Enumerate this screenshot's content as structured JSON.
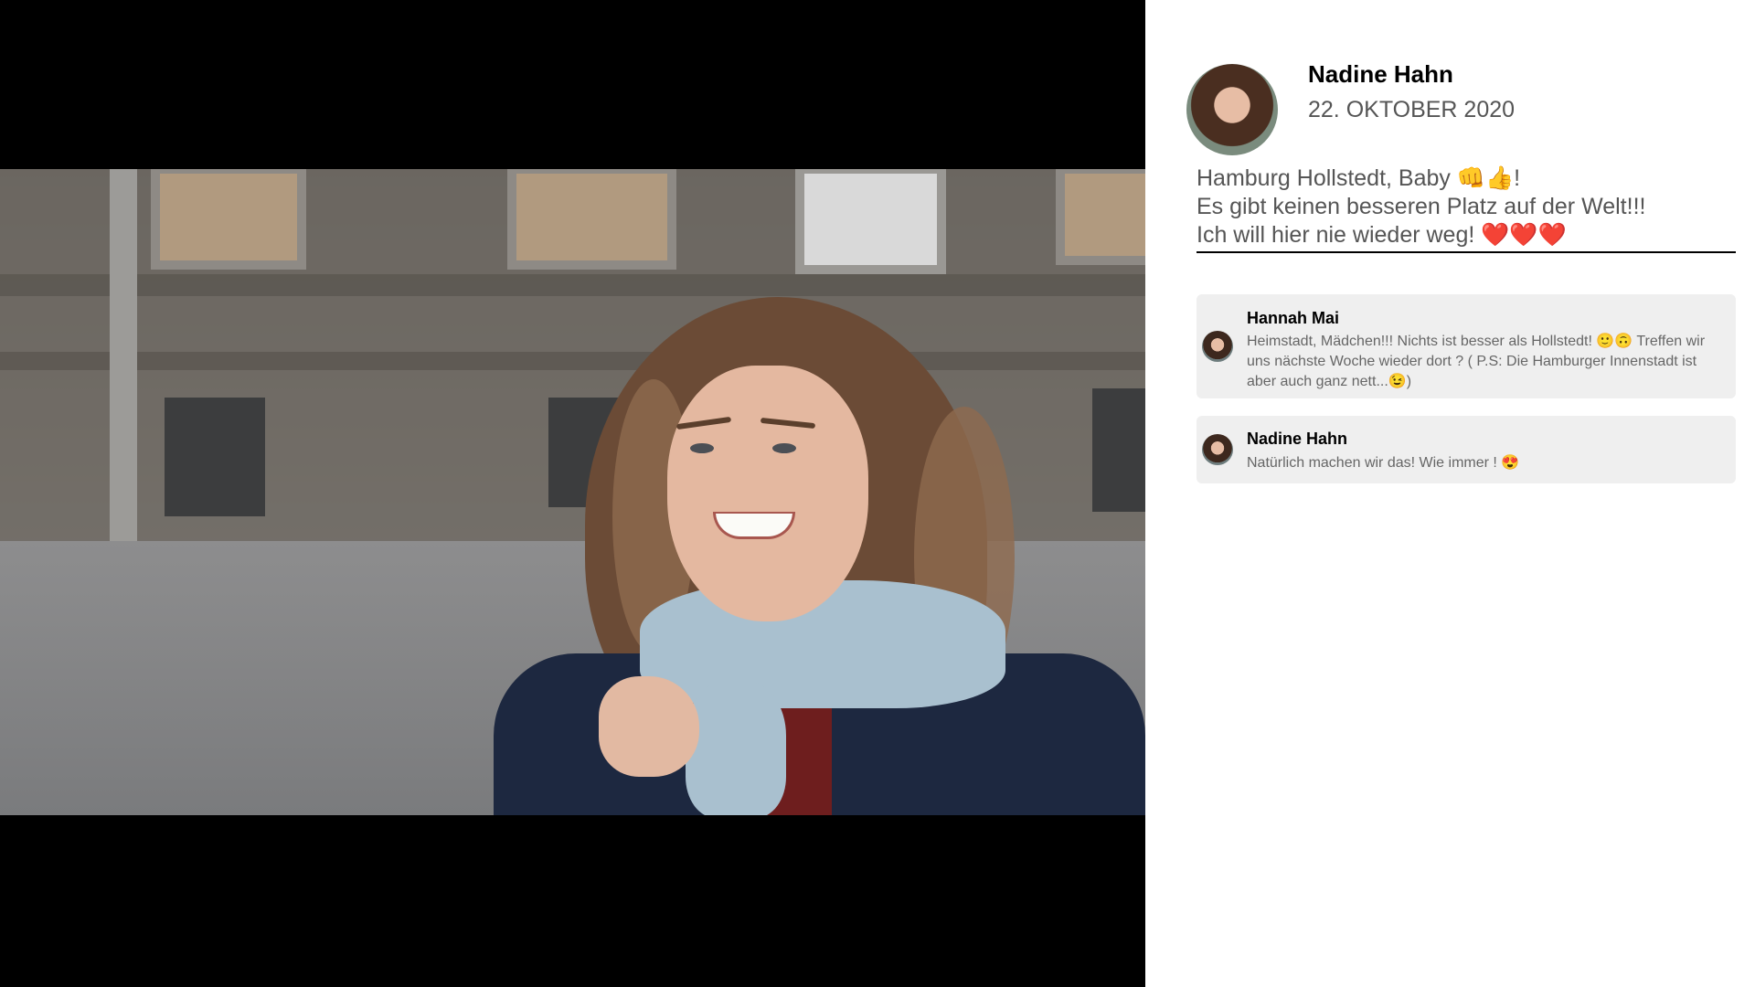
{
  "post": {
    "author": "Nadine Hahn",
    "date": "22. OKTOBER 2020",
    "caption_lines": [
      "Hamburg Hollstedt, Baby 👊👍!",
      "Es gibt keinen besseren Platz auf der Welt!!!",
      "Ich will hier nie wieder weg! ❤️❤️❤️"
    ],
    "photo_subject": "woman-with-scarf-on-street"
  },
  "comments": [
    {
      "author": "Hannah Mai",
      "text": "Heimstadt, Mädchen!!! Nichts ist besser als Hollstedt! 🙂🙃 Treffen wir uns nächste Woche wieder dort ? ( P.S: Die Hamburger Innenstadt ist aber auch ganz nett...😉)"
    },
    {
      "author": "Nadine Hahn",
      "text": "Natürlich machen wir das! Wie immer ! 😍"
    }
  ],
  "colors": {
    "background_left": "#000000",
    "panel": "#ffffff",
    "comment_bg": "#efefef",
    "text_muted": "#555555"
  }
}
